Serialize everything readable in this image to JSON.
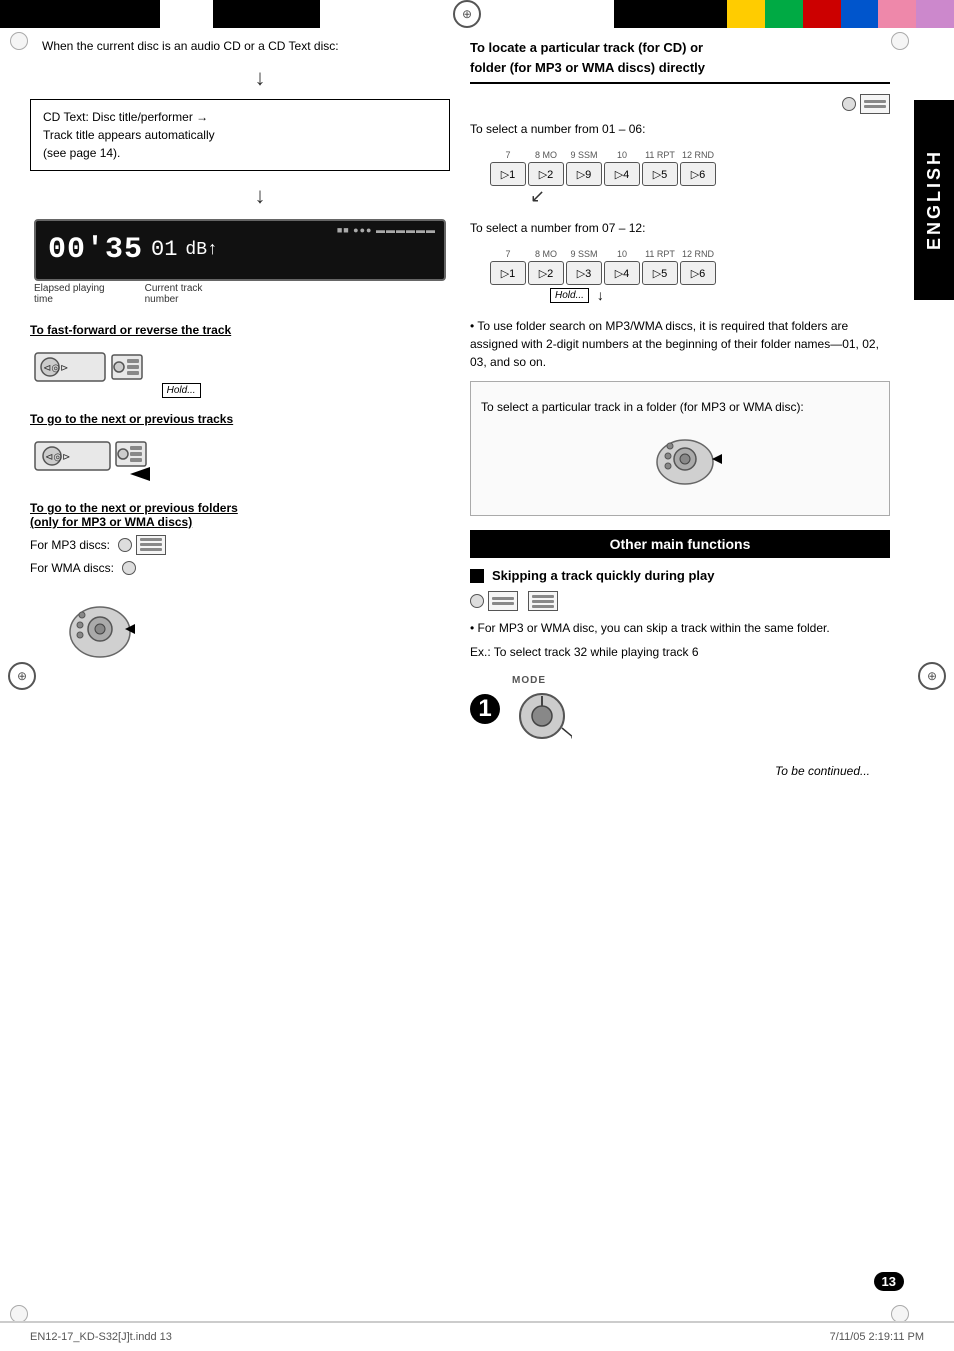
{
  "top_bar": {
    "left_blocks": [
      "black",
      "white",
      "black"
    ],
    "right_colors": [
      "black",
      "yellow",
      "green",
      "red",
      "blue",
      "pink",
      "purple"
    ]
  },
  "left_column": {
    "bullet1": "When the current disc is an audio CD or a CD Text disc:",
    "cd_text_box": {
      "line1": "CD Text: Disc title/performer →",
      "line2": "Track title appears automatically",
      "line3": "(see page 14)."
    },
    "display": {
      "digits": "00'35",
      "track": "01",
      "db_label": "dB"
    },
    "display_labels": {
      "elapsed": "Elapsed playing",
      "time": "time",
      "current": "Current track",
      "number": "number"
    },
    "fast_forward": {
      "title": "To fast-forward or reverse the track",
      "hold_label": "Hold..."
    },
    "next_prev": {
      "title": "To go to the next or previous tracks"
    },
    "next_prev_folders": {
      "title": "To go to the next or previous folders",
      "subtitle": "(only for MP3 or WMA discs)",
      "mp3_label": "For MP3 discs:",
      "wma_label": "For WMA discs:"
    }
  },
  "right_column": {
    "locate_title": "To locate a particular track (for CD) or",
    "locate_title2": "folder (for MP3 or WMA discs) directly",
    "select_01_06": "To select a number from 01 – 06:",
    "select_07_12": "To select a number from 07 – 12:",
    "hold_label": "Hold...",
    "num_buttons_row1": {
      "labels_top": [
        "7",
        "8 MO",
        "9 SSM",
        "10",
        "11 RPT",
        "12 RND"
      ],
      "numbers": [
        "▷1",
        "▷2",
        "▷9",
        "▷4",
        "▷5",
        "▷6"
      ]
    },
    "folder_note": "To use folder search on MP3/WMA discs, it is required that folders are assigned with 2-digit numbers at the beginning of their folder names—01, 02, 03, and so on.",
    "folder_track_note": "To select a particular track in a folder (for MP3 or WMA disc):",
    "other_main_functions": "Other main functions",
    "skipping_title": "Skipping a track quickly during play",
    "mp3_skip_note": "For MP3 or WMA disc, you can skip a track within the same folder.",
    "example_text": "Ex.: To select track 32 while playing track 6",
    "step1_label": "1",
    "mode_label": "MODE",
    "to_be_continued": "To be continued..."
  },
  "footer": {
    "left": "EN12-17_KD-S32[J]t.indd  13",
    "right": "7/11/05  2:19:11 PM"
  },
  "page_number": "13",
  "english_label": "ENGLISH"
}
